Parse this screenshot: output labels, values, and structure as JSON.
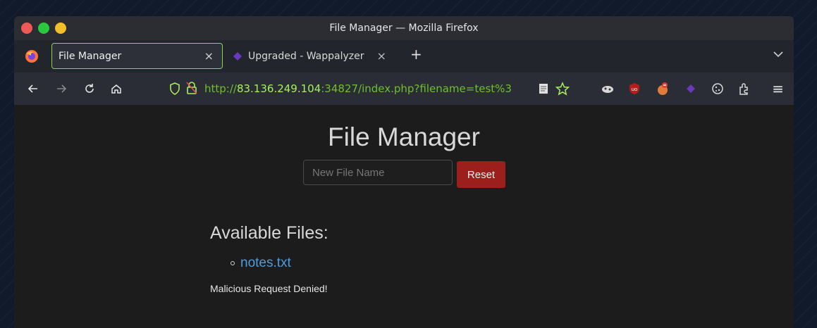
{
  "window": {
    "title": "File Manager — Mozilla Firefox"
  },
  "tabs": [
    {
      "label": "File Manager",
      "close": "×",
      "active": true
    },
    {
      "label": "Upgraded - Wappalyzer",
      "close": "×",
      "active": false
    }
  ],
  "new_tab_label": "+",
  "menu_label": "≡",
  "url": {
    "scheme": "http://",
    "host": "83.136.249.104",
    "rest": ":34827/index.php?filename=test%3"
  },
  "page": {
    "title": "File Manager",
    "input_placeholder": "New File Name",
    "reset_label": "Reset",
    "files_heading": "Available Files:",
    "files": [
      "notes.txt"
    ],
    "status": "Malicious Request Denied!"
  },
  "colors": {
    "active_tab_border": "#8fd14f",
    "url_host": "#a7f05a",
    "reset_button": "#9b1f1a",
    "link": "#4d9de0"
  }
}
